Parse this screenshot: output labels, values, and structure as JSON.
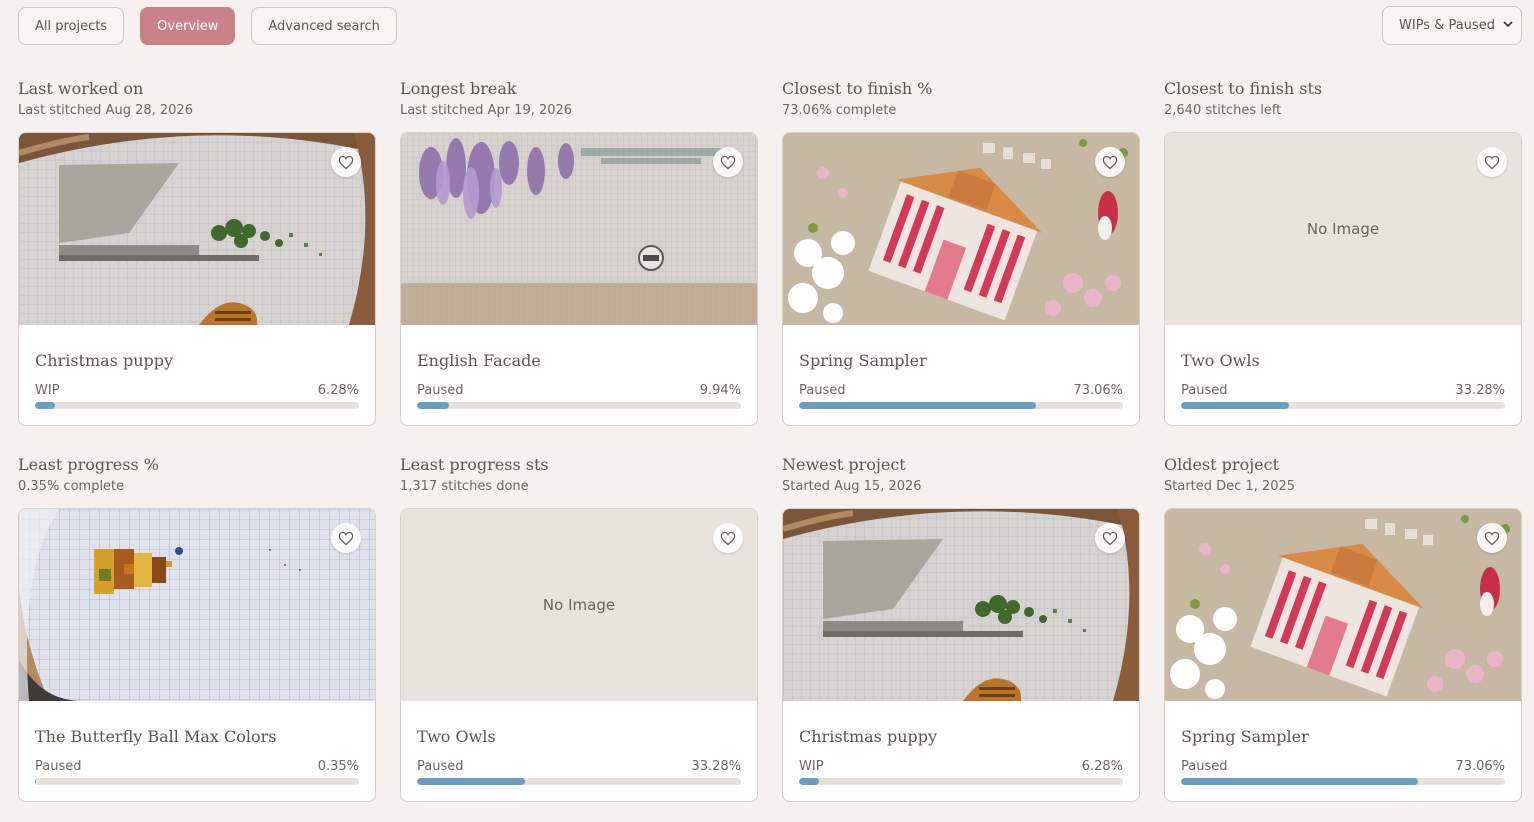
{
  "nav": {
    "tabs": [
      {
        "label": "All projects",
        "active": false
      },
      {
        "label": "Overview",
        "active": true
      },
      {
        "label": "Advanced search",
        "active": false
      }
    ]
  },
  "filter": {
    "selected": "WIPs & Paused"
  },
  "colors": {
    "accent": "#c98288",
    "progress": "#6b9fbf",
    "background": "#f6f1ee"
  },
  "sections": [
    {
      "title": "Last worked on",
      "subtitle": "Last stitched Aug 28, 2026",
      "project": {
        "name": "Christmas puppy",
        "status": "WIP",
        "percent_label": "6.28%",
        "progress": 6.28,
        "image": "hoop-landscape"
      }
    },
    {
      "title": "Longest break",
      "subtitle": "Last stitched Apr 19, 2026",
      "project": {
        "name": "English Facade",
        "status": "Paused",
        "percent_label": "9.94%",
        "progress": 9.94,
        "image": "wisteria"
      }
    },
    {
      "title": "Closest to finish %",
      "subtitle": "73.06% complete",
      "project": {
        "name": "Spring Sampler",
        "status": "Paused",
        "percent_label": "73.06%",
        "progress": 73.06,
        "image": "spring-house"
      }
    },
    {
      "title": "Closest to finish sts",
      "subtitle": "2,640 stitches left",
      "project": {
        "name": "Two Owls",
        "status": "Paused",
        "percent_label": "33.28%",
        "progress": 33.28,
        "image": "none",
        "no_image_text": "No Image"
      }
    },
    {
      "title": "Least progress %",
      "subtitle": "0.35% complete",
      "project": {
        "name": "The Butterfly Ball Max Colors",
        "status": "Paused",
        "percent_label": "0.35%",
        "progress": 0.35,
        "image": "butterfly"
      }
    },
    {
      "title": "Least progress sts",
      "subtitle": "1,317 stitches done",
      "project": {
        "name": "Two Owls",
        "status": "Paused",
        "percent_label": "33.28%",
        "progress": 33.28,
        "image": "none",
        "no_image_text": "No Image"
      }
    },
    {
      "title": "Newest project",
      "subtitle": "Started Aug 15, 2026",
      "project": {
        "name": "Christmas puppy",
        "status": "WIP",
        "percent_label": "6.28%",
        "progress": 6.28,
        "image": "hoop-landscape"
      }
    },
    {
      "title": "Oldest project",
      "subtitle": "Started Dec 1, 2025",
      "project": {
        "name": "Spring Sampler",
        "status": "Paused",
        "percent_label": "73.06%",
        "progress": 73.06,
        "image": "spring-house"
      }
    }
  ]
}
